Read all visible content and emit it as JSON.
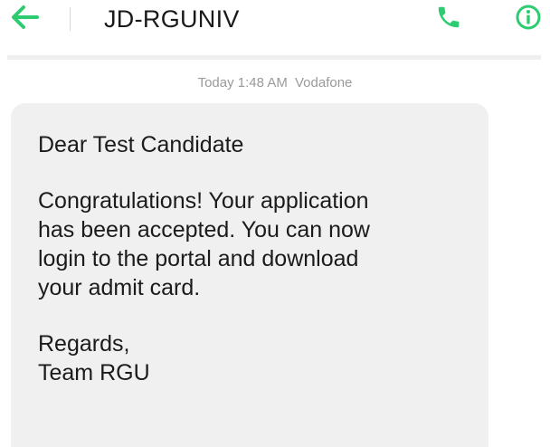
{
  "header": {
    "back_icon": "arrow-left-icon",
    "title": "JD-RGUNIV",
    "call_icon": "phone-icon",
    "info_icon": "info-circle-icon",
    "accent_color": "#2ecc71"
  },
  "message_meta": {
    "time": "Today 1:48 AM",
    "carrier": "Vodafone"
  },
  "message": {
    "greeting": "Dear Test Candidate",
    "body_lines": [
      "Congratulations! Your application",
      "has been accepted.  You can now",
      "login to the portal and download",
      "your admit card."
    ],
    "signoff_lines": [
      "Regards,",
      "Team RGU"
    ]
  }
}
